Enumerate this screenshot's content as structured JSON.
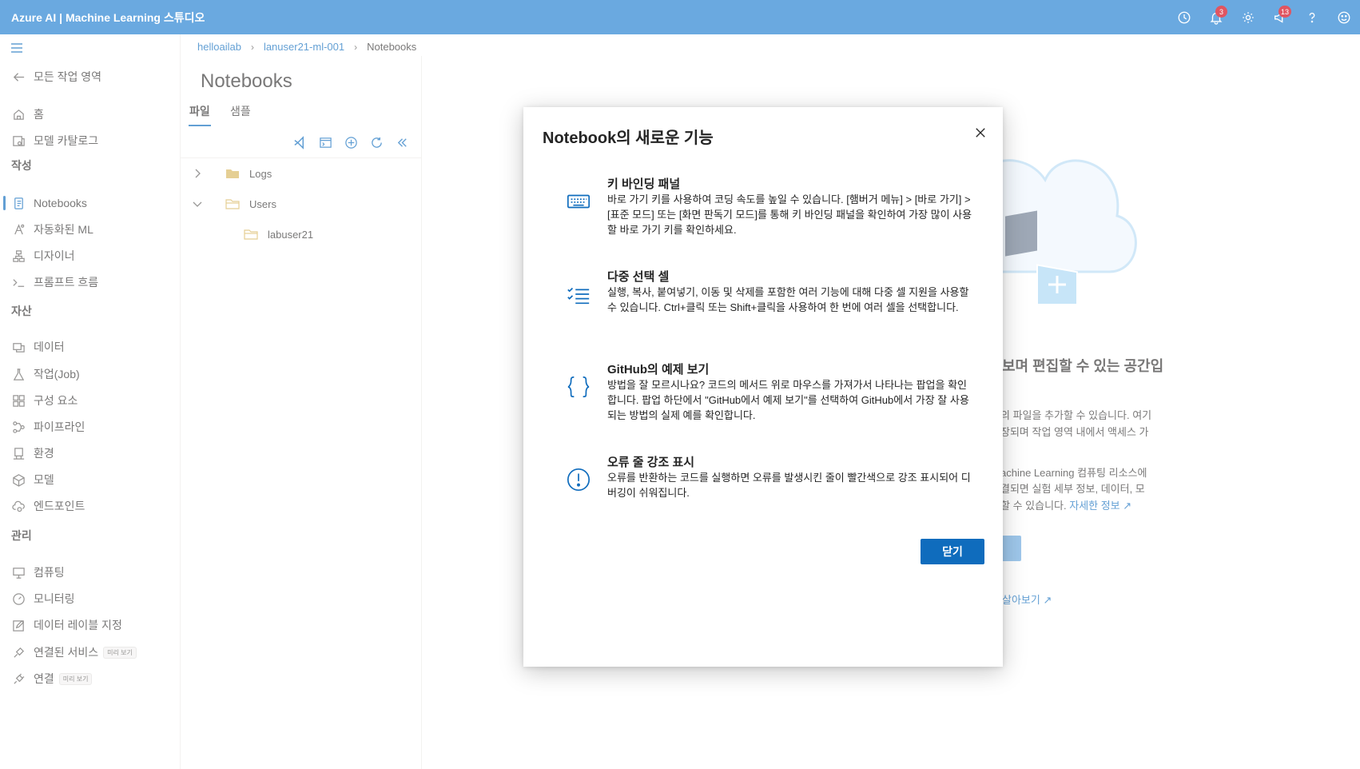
{
  "app": {
    "title": "Azure AI | Machine Learning 스튜디오"
  },
  "topbar": {
    "notifications_badge": "3",
    "feedback_badge": "13"
  },
  "nav": {
    "back": "모든 작업 영역",
    "home": "홈",
    "model_catalog": "모델 카탈로그",
    "section_author": "작성",
    "notebooks": "Notebooks",
    "automl": "자동화된 ML",
    "designer": "디자이너",
    "prompt_flow": "프롬프트 흐름",
    "section_assets": "자산",
    "data": "데이터",
    "jobs": "작업(Job)",
    "components": "구성 요소",
    "pipelines": "파이프라인",
    "environments": "환경",
    "models": "모델",
    "endpoints": "엔드포인트",
    "section_manage": "관리",
    "compute": "컴퓨팅",
    "monitoring": "모니터링",
    "data_labeling": "데이터 레이블 지정",
    "linked_services": "연결된 서비스",
    "connections": "연결",
    "preview_tag": "미리 보기"
  },
  "breadcrumb": {
    "item1": "helloailab",
    "item2": "lanuser21-ml-001",
    "current": "Notebooks"
  },
  "notebooks": {
    "title": "Notebooks",
    "tab_files": "파일",
    "tab_samples": "샘플",
    "tree": {
      "logs": "Logs",
      "users": "Users",
      "user_folder": "labuser21"
    }
  },
  "background": {
    "heading": "보며 편집할 수 있는 공간입",
    "line1": "의 파일을 추가할 수 있습니다. 여기",
    "line2": "장되며 작업 영역 내에서 액세스 가",
    "line3": "achine Learning 컴퓨팅 리소스에",
    "line4": "결되면 실험 세부 정보, 데이터, 모",
    "line5": "할 수 있습니다.",
    "learn_more": "자세한 정보",
    "link2": "살아보기"
  },
  "dialog": {
    "title": "Notebook의 새로운 기능",
    "features": [
      {
        "title": "키 바인딩 패널",
        "desc": "바로 가기 키를 사용하여 코딩 속도를 높일 수 있습니다. [햄버거 메뉴] > [바로 가기] > [표준 모드] 또는 [화면 판독기 모드]를 통해 키 바인딩 패널을 확인하여 가장 많이 사용할 바로 가기 키를 확인하세요.",
        "icon": "keyboard-icon"
      },
      {
        "title": "다중 선택 셀",
        "desc": "실행, 복사, 붙여넣기, 이동 및 삭제를 포함한 여러 기능에 대해 다중 셀 지원을 사용할 수 있습니다. Ctrl+클릭 또는 Shift+클릭을 사용하여 한 번에 여러 셀을 선택합니다.",
        "icon": "checklist-icon"
      },
      {
        "title": "GitHub의 예제 보기",
        "desc": "방법을 잘 모르시나요? 코드의 메서드 위로 마우스를 가져가서 나타나는 팝업을 확인합니다. 팝업 하단에서 \"GitHub에서 예제 보기\"를 선택하여 GitHub에서 가장 잘 사용되는 방법의 실제 예를 확인합니다.",
        "icon": "braces-icon"
      },
      {
        "title": "오류 줄 강조 표시",
        "desc": "오류를 반환하는 코드를 실행하면 오류를 발생시킨 줄이 빨간색으로 강조 표시되어 디버깅이 쉬워집니다.",
        "icon": "error-circle-icon"
      }
    ],
    "close_button": "닫기"
  },
  "colors": {
    "topbar": "#6aa9e0",
    "accent": "#0f6cbd",
    "badge": "#e05561"
  }
}
